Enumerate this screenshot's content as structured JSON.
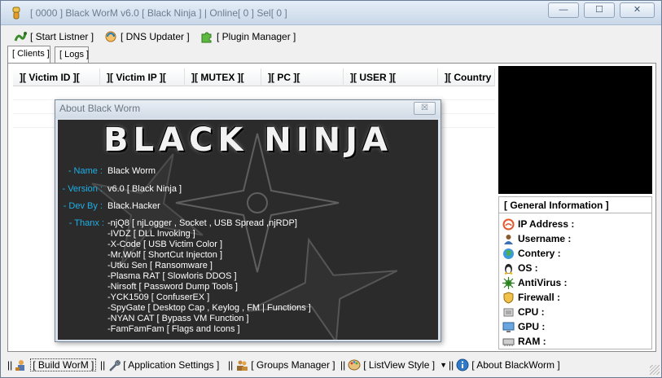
{
  "window": {
    "title": "[ 0000 ] Black WorM v6.0 [ Black Ninja ] | Online[ 0 ] Sel[ 0 ]",
    "controls": {
      "minimize": "—",
      "maximize": "☐",
      "close": "✕"
    }
  },
  "toolbar": {
    "start_listner": "[ Start Listner ]",
    "dns_updater": "[ DNS Updater ]",
    "plugin_manager": "[ Plugin Manager ]"
  },
  "tabs": [
    {
      "label": "[ Clients ]",
      "active": true
    },
    {
      "label": "[ Logs ]",
      "active": false
    }
  ],
  "clients_table": {
    "columns": [
      "][ Victim ID ][",
      "][ Victim IP ][",
      "][ MUTEX ][",
      "][ PC ][",
      "][ USER ][",
      "][ Country"
    ],
    "rows": []
  },
  "general_info": {
    "title": "[ General Information ]",
    "fields": [
      {
        "label": "IP Address :",
        "icon": "ip-icon"
      },
      {
        "label": "Username :",
        "icon": "user-icon"
      },
      {
        "label": "Contery :",
        "icon": "globe-icon"
      },
      {
        "label": "OS :",
        "icon": "linux-icon"
      },
      {
        "label": "AntiVirus :",
        "icon": "virus-icon"
      },
      {
        "label": "Firewall :",
        "icon": "shield-icon"
      },
      {
        "label": "CPU :",
        "icon": "cpu-icon"
      },
      {
        "label": "GPU :",
        "icon": "gpu-icon"
      },
      {
        "label": "RAM :",
        "icon": "ram-icon"
      }
    ]
  },
  "bottom_bar": {
    "build_worm": "[ Build WorM ]",
    "app_settings": "[ Application Settings ]",
    "groups_manager": "[ Groups Manager ]",
    "listview_style": "[ ListView Style ]",
    "about": "[ About BlackWorm ]",
    "separator": "||"
  },
  "about_dialog": {
    "title": "About Black Worm",
    "close": "☒",
    "logo": "BLACK NINJA",
    "name_label": "- Name :",
    "name_value": "Black Worm",
    "version_label": "- Version :",
    "version_value": "v6.0 [ Black Ninja ]",
    "dev_label": "- Dev By :",
    "dev_value": "Black.Hacker",
    "thanx_label": "- Thanx :",
    "thanx": [
      "-njQ8 [ njLogger , Socket , USB Spread ,njRDP]",
      "-IVDZ [ DLL Invoking ]",
      "-X-Code  [ USB Victim Color ]",
      "-Mr.Wolf [ ShortCut Injecton ]",
      "-Utku Sen [ Ransomware ]",
      "-Plasma RAT [ Slowloris DDOS ]",
      "-Nirsoft  [ Password Dump Tools ]",
      "-YCK1509 [ ConfuserEX ]",
      "-SpyGate [ Desktop Cap , Keylog , FM | Functions ]",
      "-NYAN CAT [ Bypass VM Function ]",
      "-FamFamFam [ Flags and Icons ]"
    ]
  },
  "colors": {
    "accent_label": "#1db0e8",
    "dialog_bg": "#2b2b2b",
    "preview_bg": "#000000"
  }
}
